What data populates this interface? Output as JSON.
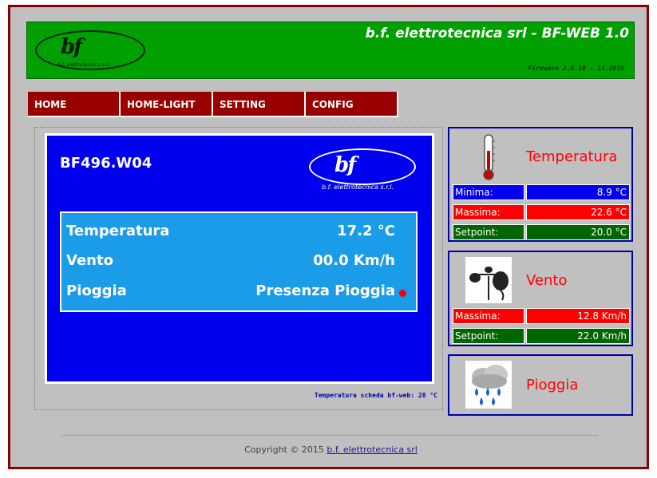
{
  "header": {
    "logo_mark": "bf",
    "logo_sub": "b.f. elettrotecnica s.r.l.",
    "title": "b.f. elettrotecnica srl - BF-WEB 1.0",
    "firmware": "Firmware 2.0.10 - 11.2015"
  },
  "nav": [
    {
      "label": "HOME"
    },
    {
      "label": "HOME-LIGHT"
    },
    {
      "label": "SETTING"
    },
    {
      "label": "CONFIG"
    }
  ],
  "main": {
    "device_name": "BF496.W04",
    "logo_mark": "bf",
    "logo_sub": "b.f. elettrotecnica s.r.l.",
    "readings": [
      {
        "label": "Temperatura",
        "value": "17.2 °C"
      },
      {
        "label": "Vento",
        "value": "00.0 Km/h"
      },
      {
        "label": "Pioggia",
        "value": "Presenza Pioggia"
      }
    ],
    "rain_indicator_color": "#ff0000",
    "board_temp": "Temperatura scheda bf-web: 28  °C"
  },
  "side": {
    "temperatura": {
      "title": "Temperatura",
      "icon": "thermometer-icon",
      "rows": [
        {
          "label": "Minima:",
          "value": "8.9 °C",
          "color": "#0000ee"
        },
        {
          "label": "Massima:",
          "value": "22.6 °C",
          "color": "#ff0000"
        },
        {
          "label": "Setpoint:",
          "value": "20.0 °C",
          "color": "#006600"
        }
      ]
    },
    "vento": {
      "title": "Vento",
      "icon": "anemometer-icon",
      "rows": [
        {
          "label": "Massima:",
          "value": "12.8 Km/h",
          "color": "#ff0000"
        },
        {
          "label": "Setpoint:",
          "value": "22.0 Km/h",
          "color": "#006600"
        }
      ]
    },
    "pioggia": {
      "title": "Pioggia",
      "icon": "rain-cloud-icon"
    }
  },
  "footer": {
    "copyright_prefix": "Copyright © 2015 ",
    "copyright_link": "b.f. elettrotecnica srl"
  },
  "colors": {
    "frame": "#8b0000",
    "header_bg": "#00a000",
    "nav_bg": "#990000",
    "panel_blue": "#0000ee",
    "readings_bg": "#1a9ce8"
  }
}
